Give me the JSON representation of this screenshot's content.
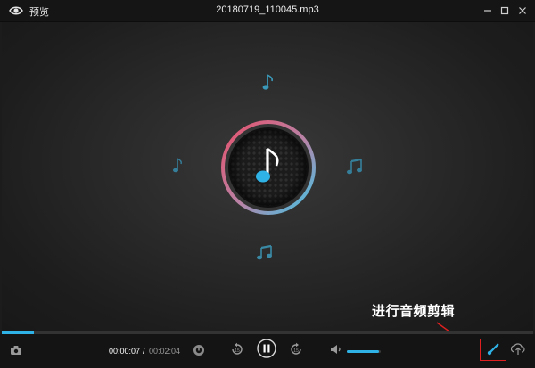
{
  "window": {
    "app_title": "预览",
    "file_title": "20180719_110045.mp3",
    "icons": {
      "app": "eye-icon",
      "minimize": "minimize-icon",
      "maximize": "maximize-icon",
      "close": "close-icon"
    }
  },
  "player": {
    "current_time": "00:00:07",
    "time_separator": "/",
    "total_time": "00:02:04",
    "progress": 0.06,
    "volume": 0.95,
    "rewind_seconds": "15",
    "forward_seconds": "15",
    "state": "playing"
  },
  "annotation": {
    "label": "进行音频剪辑",
    "highlight_color": "#e02020"
  },
  "colors": {
    "accent": "#2fb3e6",
    "ring_start": "#e8506a",
    "ring_end": "#3ec6e8",
    "background": "#1c1c1c"
  },
  "icons": {
    "screenshot": "camera-icon",
    "speed": "speed-icon",
    "rewind": "rewind-15-icon",
    "play_pause": "pause-icon",
    "forward": "forward-15-icon",
    "volume": "volume-icon",
    "edit": "audio-edit-icon",
    "export": "export-icon"
  }
}
